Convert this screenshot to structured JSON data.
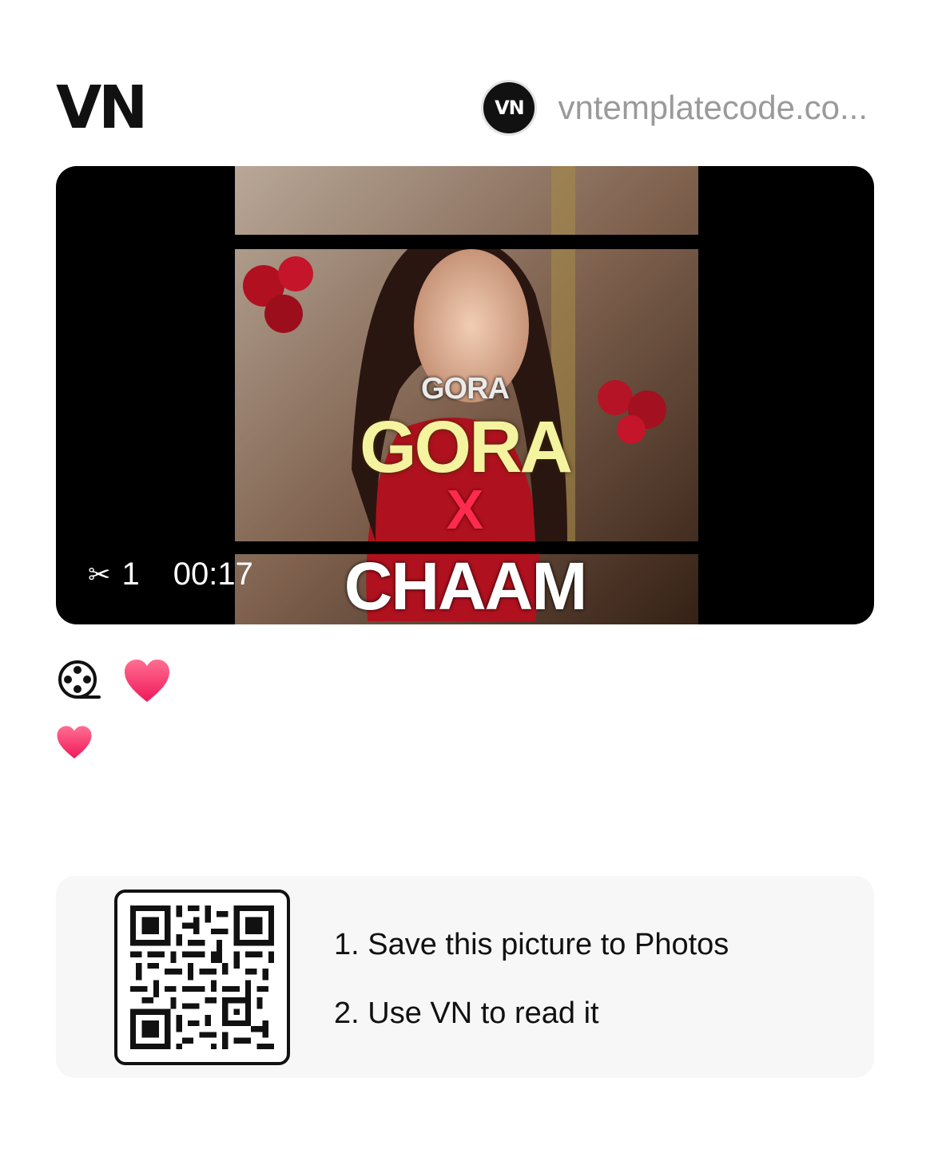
{
  "header": {
    "logo": "VN",
    "author_avatar": "VN",
    "author_name": "vntemplatecode.co..."
  },
  "video": {
    "clip_count": "1",
    "duration": "00:17",
    "overlay_lines": [
      "GORA",
      "GORA",
      "X",
      "CHAAM"
    ],
    "scissors_icon": "scissors-icon"
  },
  "reactions": {
    "icons": [
      "film-reel-icon",
      "heart-icon"
    ]
  },
  "description": {
    "icon": "heart-icon"
  },
  "qr_card": {
    "step1": "1. Save this picture to Photos",
    "step2": "2. Use VN to read it"
  },
  "colors": {
    "heart": "#ff3b6b",
    "card_bg": "#f7f7f7",
    "author_text": "#9a9a9a"
  }
}
